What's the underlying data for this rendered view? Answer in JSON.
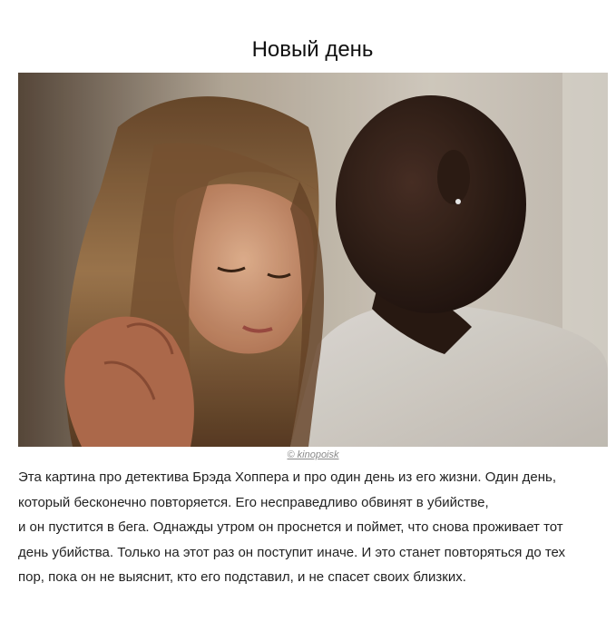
{
  "article": {
    "title": "Новый день",
    "image_credit": "© kinopoisk",
    "body_lines": [
      "Эта картина про детектива Брэда Хоппера и про один день из его жизни. Один день,",
      "который бесконечно повторяется. Его несправедливо обвинят в убийстве,",
      "и он пустится в бега. Однажды утром он проснется и поймет, что снова проживает тот",
      "день убийства. Только на этот раз он поступит иначе. И это станет повторяться до тех",
      "пор, пока он не выяснит, кто его подставил, и не спасет своих близких."
    ]
  }
}
